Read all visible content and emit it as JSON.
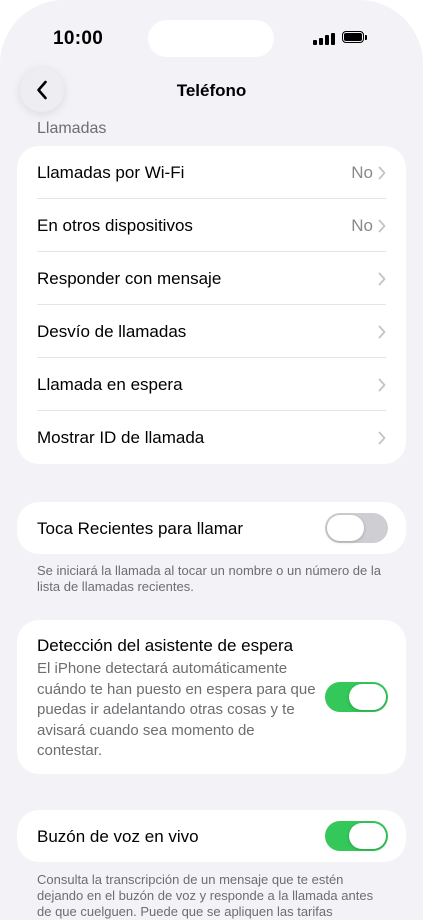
{
  "status_bar": {
    "time": "10:00"
  },
  "nav": {
    "title": "Teléfono",
    "back_icon": "chevron-left-icon"
  },
  "section_calls": {
    "header": "Llamadas",
    "rows": [
      {
        "label": "Llamadas por Wi-Fi",
        "value": "No"
      },
      {
        "label": "En otros dispositivos",
        "value": "No"
      },
      {
        "label": "Responder con mensaje",
        "value": ""
      },
      {
        "label": "Desvío de llamadas",
        "value": ""
      },
      {
        "label": "Llamada en espera",
        "value": ""
      },
      {
        "label": "Mostrar ID de llamada",
        "value": ""
      }
    ]
  },
  "recents": {
    "label": "Toca Recientes para llamar",
    "on": false,
    "footer": "Se iniciará la llamada al tocar un nombre o un número de la lista de llamadas recientes."
  },
  "hold_assist": {
    "title": "Detección del asistente de espera",
    "description": "El iPhone detectará automáticamente cuándo te han puesto en espera para que puedas ir adelantando otras cosas y te avisará cuando sea momento de contestar.",
    "on": true
  },
  "live_voicemail": {
    "label": "Buzón de voz en vivo",
    "on": true,
    "footer": "Consulta la transcripción de un mensaje que te estén dejando en el buzón de voz y responde a la llamada antes de que cuelguen. Puede que se apliquen las tarifas"
  },
  "colors": {
    "toggle_on": "#34c759",
    "toggle_off": "#cfcfd3",
    "background": "#f2f2f7"
  }
}
